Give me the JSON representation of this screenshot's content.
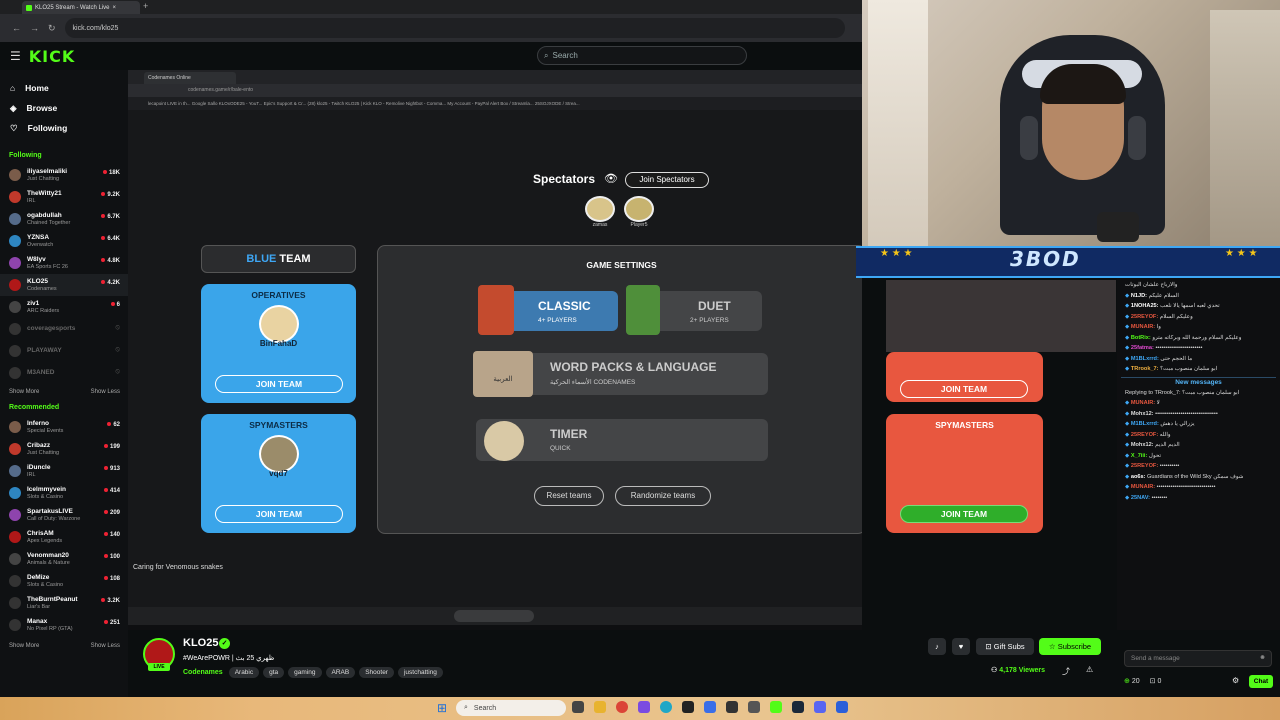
{
  "browser": {
    "tab_title": "KLO25 Stream - Watch Live",
    "new_tab": "+",
    "url": "kick.com/klo25"
  },
  "header": {
    "logo": "KICK",
    "search_placeholder": "Search"
  },
  "sidebar": {
    "nav": [
      {
        "label": "Home",
        "icon": "home-icon"
      },
      {
        "label": "Browse",
        "icon": "browse-icon"
      },
      {
        "label": "Following",
        "icon": "heart-icon"
      }
    ],
    "following_title": "Following",
    "following": [
      {
        "name": "iliyaselmaliki",
        "category": "Just Chatting",
        "viewers": "18K",
        "live": true
      },
      {
        "name": "TheWitty21",
        "category": "IRL",
        "viewers": "9.2K",
        "live": true
      },
      {
        "name": "ogabdullah",
        "category": "Chained Together",
        "viewers": "6.7K",
        "live": true
      },
      {
        "name": "YZNSA",
        "category": "Overwatch",
        "viewers": "6.4K",
        "live": true
      },
      {
        "name": "W8lyv",
        "category": "EA Sports FC 26",
        "viewers": "4.8K",
        "live": true
      },
      {
        "name": "KLO25",
        "category": "Codenames",
        "viewers": "4.2K",
        "live": true,
        "active": true
      },
      {
        "name": "ziv1",
        "category": "ARC Raiders",
        "viewers": "6",
        "live": true
      },
      {
        "name": "coveragesports",
        "category": "",
        "viewers": "",
        "live": false
      },
      {
        "name": "PLAYAWAY",
        "category": "",
        "viewers": "",
        "live": false
      },
      {
        "name": "M3ANED",
        "category": "",
        "viewers": "",
        "live": false
      }
    ],
    "show_more": "Show More",
    "show_less": "Show Less",
    "recommended_title": "Recommended",
    "recommended": [
      {
        "name": "Inferno",
        "category": "Special Events",
        "viewers": "62"
      },
      {
        "name": "Cribazz",
        "category": "Just Chatting",
        "viewers": "199"
      },
      {
        "name": "iDuncle",
        "category": "IRL",
        "viewers": "913"
      },
      {
        "name": "Icelmmyvein",
        "category": "Slots & Casino",
        "viewers": "414"
      },
      {
        "name": "SpartakusLIVE",
        "category": "Call of Duty: Warzone",
        "viewers": "209"
      },
      {
        "name": "ChrisAM",
        "category": "Apex Legends",
        "viewers": "140"
      },
      {
        "name": "Venomman20",
        "category": "Animals & Nature",
        "viewers": "100"
      },
      {
        "name": "DeMize",
        "category": "Slots & Casino",
        "viewers": "108"
      },
      {
        "name": "TheBurntPeanut",
        "category": "Liar's Bar",
        "viewers": "3.2K"
      },
      {
        "name": "Manax",
        "category": "No Pixel RP (GTA)",
        "viewers": "251"
      }
    ]
  },
  "stream": {
    "inner_tab": "Codenames Online",
    "inner_url": "codenames.game/r/bale-ento",
    "bookmarks": "lecapoint LIVE in th...  Google  Sallo  KLOxODE25 - YouT...  Epic's Support & Cr...  (28) klo25 - Twitch  KLO25 | Kick  KLO - Remolive  Nightbot - Comma...  My Account - PayPal  Alert Box / Streamla...  25SOJXODE / Strea...",
    "caption": "Caring for Venomous snakes"
  },
  "game": {
    "spectators_title": "Spectators",
    "join_spectators": "Join Spectators",
    "spectators": [
      "zamas",
      "Player5"
    ],
    "blue_team_prefix": "BLUE",
    "blue_team_suffix": "TEAM",
    "operatives": "OPERATIVES",
    "spymasters": "SPYMASTERS",
    "blue_operative_player": "BinFahaD",
    "blue_spymaster_player": "vqd7",
    "join_team": "JOIN TEAM",
    "settings_title": "GAME SETTINGS",
    "classic": "CLASSIC",
    "classic_sub": "4+ PLAYERS",
    "duet": "DUET",
    "duet_sub": "2+ PLAYERS",
    "wordpacks": "WORD PACKS & LANGUAGE",
    "wordpacks_sub": "الأسماء الحركية CODENAMES",
    "wordpacks_badge": "العربية",
    "timer": "TIMER",
    "timer_sub": "QUICK",
    "reset_teams": "Reset teams",
    "randomize_teams": "Randomize teams",
    "red_join_team": "JOIN TEAM",
    "red_spymasters": "SPYMASTERS"
  },
  "overlay": {
    "banner_text": "3BOD"
  },
  "chat": {
    "messages": [
      {
        "user": "",
        "text": "والارباح علشان البوتات",
        "color": "#dddddd"
      },
      {
        "user": "N1JD:",
        "text": "السلام عليكم",
        "color": "#ffffff"
      },
      {
        "user": "1NOHA25:",
        "text": "تحدي لعبه اسمها يالا نلعب",
        "color": "#ffffff"
      },
      {
        "user": "25REYOF:",
        "text": "وعليكم السلام",
        "color": "#e8573f"
      },
      {
        "user": "MUNAIR:",
        "text": "وا",
        "color": "#e8573f"
      },
      {
        "user": "BotRix:",
        "text": "وعليكم السلام ورحمة الله وبركاته مترو",
        "color": "#53fc18"
      },
      {
        "user": "25fatma:",
        "text": "••••••••••••••••••••••••",
        "color": "#e04ad0"
      },
      {
        "user": "M1BLxrrd:",
        "text": "ما الحجم حتى",
        "color": "#3ea7f5"
      },
      {
        "user": "TRrook_7:",
        "text": "ابو سلمان منصوب مبت؟",
        "color": "#f0b040"
      }
    ],
    "new_messages_label": "New messages",
    "new_messages": [
      {
        "user": "",
        "text": "Replying to TRrook_7: ابو سلمان منصوب مبت؟",
        "color": "#999999"
      },
      {
        "user": "MUNAIR:",
        "text": "لا",
        "color": "#e8573f"
      },
      {
        "user": "Mohx12:",
        "text": "••••••••••••••••••••••••••••••••",
        "color": "#dddddd"
      },
      {
        "user": "M1BLxrrd:",
        "text": "يزرالي يا دهش",
        "color": "#3ea7f5"
      },
      {
        "user": "25REYOF:",
        "text": "والله",
        "color": "#e8573f"
      },
      {
        "user": "Mohx12:",
        "text": "الديم الديم",
        "color": "#dddddd"
      },
      {
        "user": "X_7iii:",
        "text": "تحول",
        "color": "#53fc18"
      },
      {
        "user": "25REYOF:",
        "text": "••••••••••",
        "color": "#e8573f"
      },
      {
        "user": "ao6s:",
        "text": "Guardians of the Wild Sky شوف سمكن",
        "color": "#ffffff"
      },
      {
        "user": "MUNAIR:",
        "text": "••••••••••••••••••••••••••••••",
        "color": "#e8573f"
      },
      {
        "user": "25NAV:",
        "text": "••••••••",
        "color": "#3ea7f5"
      }
    ],
    "input_placeholder": "Send a message",
    "points": "20",
    "gifts": "0",
    "chat_button": "Chat"
  },
  "channel": {
    "name": "KLO25",
    "live_badge": "LIVE",
    "title": "#WeArePOWR | ظهري 25 بث",
    "category": "Codenames",
    "tags": [
      "Arabic",
      "gta",
      "gaming",
      "ARAB",
      "Shooter",
      "justchatting"
    ],
    "gift_subs": "Gift Subs",
    "subscribe": "Subscribe",
    "viewers": "4,178 Viewers"
  },
  "taskbar": {
    "search": "Search"
  }
}
